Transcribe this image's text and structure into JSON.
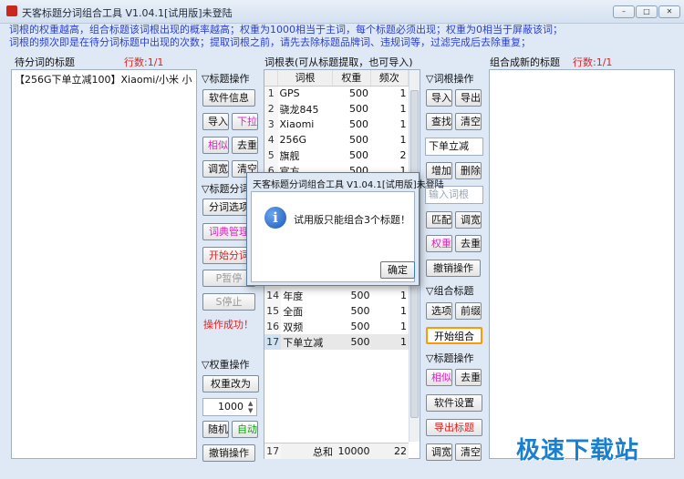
{
  "window": {
    "title": "天客标题分词组合工具 V1.04.1[试用版]未登陆",
    "controls": [
      "–",
      "□",
      "✕"
    ]
  },
  "description": {
    "line1": "词根的权重越高，组合标题该词根出现的概率越高；权重为1000相当于主词，每个标题必须出现；权重为0相当于屏蔽该词；",
    "line2": "词根的频次即是在待分词标题中出现的次数；提取词根之前，请先去除标题品牌词、违规词等，过滤完成后去除重复；"
  },
  "left_panel": {
    "label": "待分词的标题",
    "count": "行数:1/1",
    "items": [
      "【256G下单立减100】Xiaomi/小米 小"
    ]
  },
  "title_ops": {
    "heading": "▽标题操作",
    "software_info": "软件信息",
    "import": "导入",
    "pull": "下拉",
    "similar": "相似",
    "dedupe": "去重",
    "widen": "调宽",
    "clear": "清空"
  },
  "segment_ops": {
    "heading": "▽标题分词",
    "options": "分词选项",
    "dict_manage": "词典管理",
    "start": "开始分词",
    "pause": "P暂停",
    "stop": "S停止",
    "status": "操作成功！"
  },
  "weight_ops": {
    "heading": "▽权重操作",
    "change": "权重改为",
    "value": "1000",
    "random": "随机",
    "auto": "自动",
    "undo": "撤销操作"
  },
  "word_table": {
    "label": "词根表(可从标题提取，也可导入)",
    "headers": [
      "词根",
      "权重",
      "频次"
    ],
    "rows": [
      {
        "n": "1",
        "word": "GPS",
        "weight": "500",
        "freq": "1"
      },
      {
        "n": "2",
        "word": "骁龙845",
        "weight": "500",
        "freq": "1"
      },
      {
        "n": "3",
        "word": "Xiaomi",
        "weight": "500",
        "freq": "1"
      },
      {
        "n": "4",
        "word": "256G",
        "weight": "500",
        "freq": "1"
      },
      {
        "n": "5",
        "word": "旗舰",
        "weight": "500",
        "freq": "2"
      },
      {
        "n": "6",
        "word": "官方",
        "weight": "500",
        "freq": "1"
      }
    ],
    "rows_lower": [
      {
        "n": "14",
        "word": "年度",
        "weight": "500",
        "freq": "1"
      },
      {
        "n": "15",
        "word": "全面",
        "weight": "500",
        "freq": "1"
      },
      {
        "n": "16",
        "word": "双频",
        "weight": "500",
        "freq": "1"
      },
      {
        "n": "17",
        "word": "下单立减",
        "weight": "500",
        "freq": "1"
      }
    ],
    "footer": {
      "n": "17",
      "label": "总和",
      "weight": "10000",
      "freq": "22"
    }
  },
  "word_ops": {
    "heading": "▽词根操作",
    "import": "导入",
    "export": "导出",
    "find": "查找",
    "clear": "清空",
    "search_value": "下单立减",
    "add": "增加",
    "delete": "删除",
    "input_placeholder": "输入词根",
    "match": "匹配",
    "widen": "调宽",
    "weight": "权重",
    "dedupe": "去重",
    "undo": "撤销操作"
  },
  "combine_ops": {
    "heading": "▽组合标题",
    "options": "选项",
    "prefix": "前缀",
    "start": "开始组合"
  },
  "result_ops": {
    "heading": "▽标题操作",
    "similar": "相似",
    "dedupe": "去重",
    "settings": "软件设置",
    "export": "导出标题",
    "widen": "调宽",
    "clear": "清空"
  },
  "right_panel": {
    "label": "组合成新的标题",
    "count": "行数:1/1"
  },
  "dialog": {
    "title": "天客标题分词组合工具 V1.04.1[试用版]未登陆",
    "message": "试用版只能组合3个标题！",
    "ok": "确定",
    "icon": "info-icon"
  },
  "watermark": "极速下载站",
  "colors": {
    "accent_blue": "#2a3fd6",
    "red": "#e02020",
    "pink": "#e020c0",
    "green": "#10a010",
    "orange": "#ff9900"
  }
}
